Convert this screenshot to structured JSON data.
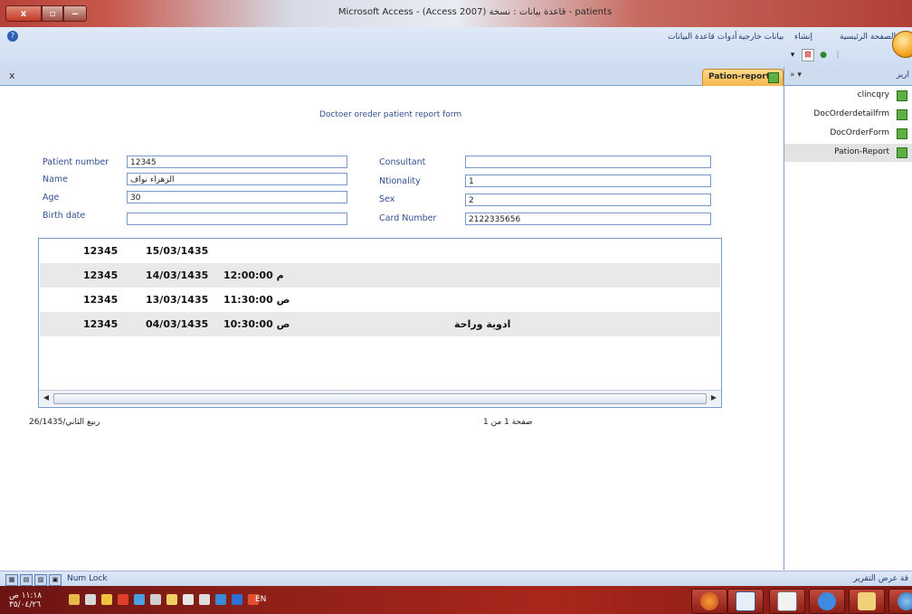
{
  "window": {
    "title": "Microsoft Access - (Access 2007) قاعدة بيانات : نسخة - patients",
    "buttons": {
      "close": "x",
      "maximize": "▫",
      "minimize": "‒"
    }
  },
  "ribbon": {
    "tabs": [
      "الصفحة الرئيسية",
      "إنشاء",
      "بيانات خارجية",
      "أدوات قاعدة البيانات"
    ],
    "help_icon": "help-icon"
  },
  "document": {
    "close": "x",
    "tab_label": "Pation-report"
  },
  "report": {
    "title": "Doctoer oreder  patient report form",
    "fields": {
      "patient_number": {
        "label": "Patient number",
        "value": "12345"
      },
      "name": {
        "label": "Name",
        "value": "الزهراء نواف"
      },
      "age": {
        "label": "Age",
        "value": "30"
      },
      "birth_date": {
        "label": "Birth date",
        "value": ""
      },
      "consultant": {
        "label": "Consultant",
        "value": ""
      },
      "nationality": {
        "label": "Ntionality",
        "value": "1"
      },
      "sex": {
        "label": "Sex",
        "value": "2"
      },
      "card_number": {
        "label": "Card Number",
        "value": "2122335656"
      }
    },
    "rows": [
      {
        "id": "12345",
        "date": "15/03/1435",
        "time": "",
        "note": ""
      },
      {
        "id": "12345",
        "date": "14/03/1435",
        "time": "12:00:00 م",
        "note": ""
      },
      {
        "id": "12345",
        "date": "13/03/1435",
        "time": "11:30:00 ص",
        "note": ""
      },
      {
        "id": "12345",
        "date": "04/03/1435",
        "time": "10:30:00 ص",
        "note": "ادوية وراحة"
      }
    ],
    "footer": {
      "date": "26/ربيع الثاني/1435",
      "page": "صفحة 1 من 1"
    }
  },
  "nav_pane": {
    "title": "ارير",
    "collapse": "»",
    "items": [
      "clincqry",
      "DocOrderdetailfrm",
      "DocOrderForm",
      "Pation-Report"
    ],
    "selected_index": 3
  },
  "status_bar": {
    "num_lock": "Num Lock",
    "view_name": "قة عرض التقرير"
  },
  "taskbar": {
    "time": "١١:١٨ ص",
    "date": "٣٥/٠٤/٢٦",
    "language": "EN"
  }
}
